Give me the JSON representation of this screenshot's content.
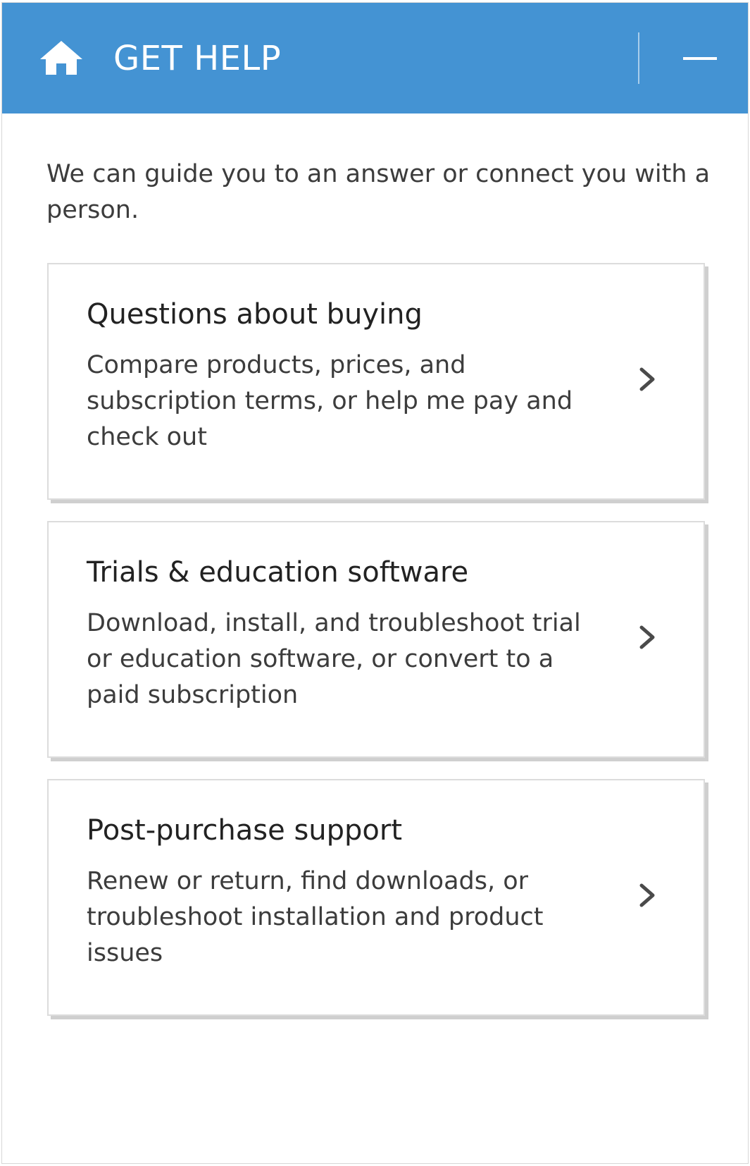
{
  "header": {
    "title": "GET HELP",
    "icon": "home-icon",
    "minimize_icon": "minimize-icon",
    "background_color": "#4493d3"
  },
  "intro": {
    "text": "We can guide you to an answer or connect you with a person."
  },
  "cards": [
    {
      "title": "Questions about buying",
      "description": "Compare products, prices, and subscription terms, or help me pay and check out",
      "icon": "chevron-right-icon"
    },
    {
      "title": "Trials & education software",
      "description": "Download, install, and troubleshoot trial or education software, or convert to a paid subscription",
      "icon": "chevron-right-icon"
    },
    {
      "title": "Post-purchase support",
      "description": "Renew or return, find downloads, or troubleshoot installation and product issues",
      "icon": "chevron-right-icon"
    }
  ]
}
